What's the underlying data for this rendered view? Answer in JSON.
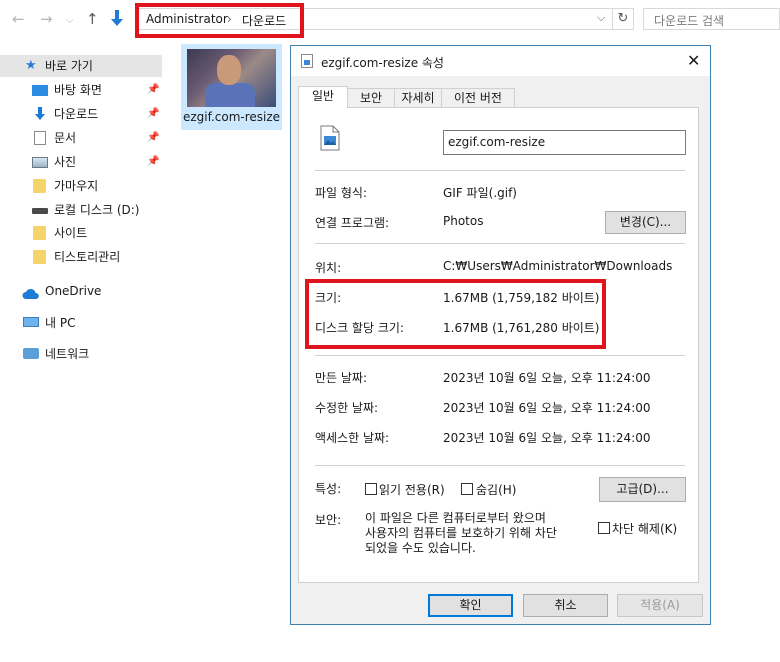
{
  "explorer": {
    "address": {
      "crumbs": [
        "Administrator",
        "다운로드"
      ],
      "separator": "›"
    },
    "search_placeholder": "다운로드 검색",
    "sidebar": {
      "items": [
        {
          "label": "바로 가기",
          "icon": "star-icon",
          "pinned": false
        },
        {
          "label": "바탕 화면",
          "icon": "desktop-icon",
          "pinned": true
        },
        {
          "label": "다운로드",
          "icon": "download-arrow-icon",
          "pinned": true
        },
        {
          "label": "문서",
          "icon": "document-icon",
          "pinned": true
        },
        {
          "label": "사진",
          "icon": "pictures-icon",
          "pinned": true
        },
        {
          "label": "가마우지",
          "icon": "folder-icon",
          "pinned": false
        },
        {
          "label": "로컬 디스크 (D:)",
          "icon": "drive-icon",
          "pinned": false
        },
        {
          "label": "사이트",
          "icon": "folder-icon",
          "pinned": false
        },
        {
          "label": "티스토리관리",
          "icon": "folder-icon",
          "pinned": false
        },
        {
          "label": "OneDrive",
          "icon": "cloud-icon",
          "pinned": false
        },
        {
          "label": "내 PC",
          "icon": "pc-icon",
          "pinned": false
        },
        {
          "label": "네트워크",
          "icon": "network-icon",
          "pinned": false
        }
      ]
    },
    "file": {
      "name": "ezgif.com-resize"
    }
  },
  "dialog": {
    "title": "ezgif.com-resize 속성",
    "tabs": [
      "일반",
      "보안",
      "자세히",
      "이전 버전"
    ],
    "active_tab": "일반",
    "filename": "ezgif.com-resize",
    "props": {
      "type_label": "파일 형식:",
      "type_value": "GIF 파일(.gif)",
      "program_label": "연결 프로그램:",
      "program_value": "Photos",
      "change_button": "변경(C)...",
      "location_label": "위치:",
      "location_value": "C:₩Users₩Administrator₩Downloads",
      "size_label": "크기:",
      "size_value": "1.67MB (1,759,182 바이트)",
      "disk_size_label": "디스크 할당 크기:",
      "disk_size_value": "1.67MB (1,761,280 바이트)",
      "created_label": "만든 날짜:",
      "created_value": "2023년 10월 6일 오늘, 오후 11:24:00",
      "modified_label": "수정한 날짜:",
      "modified_value": "2023년 10월 6일 오늘, 오후 11:24:00",
      "accessed_label": "액세스한 날짜:",
      "accessed_value": "2023년 10월 6일 오늘, 오후 11:24:00",
      "attributes_label": "특성:",
      "readonly_label": "읽기 전용(R)",
      "hidden_label": "숨김(H)",
      "advanced_button": "고급(D)...",
      "security_label": "보안:",
      "security_text": [
        "이 파일은 다른 컴퓨터로부터 왔으며",
        "사용자의 컴퓨터를 보호하기 위해 차단",
        "되었을 수도 있습니다."
      ],
      "unblock_label": "차단 해제(K)"
    },
    "buttons": {
      "ok": "확인",
      "cancel": "취소",
      "apply": "적용(A)"
    }
  },
  "colors": {
    "highlight": "#e0141c",
    "accent": "#0078d7",
    "selection": "#cce8ff"
  }
}
